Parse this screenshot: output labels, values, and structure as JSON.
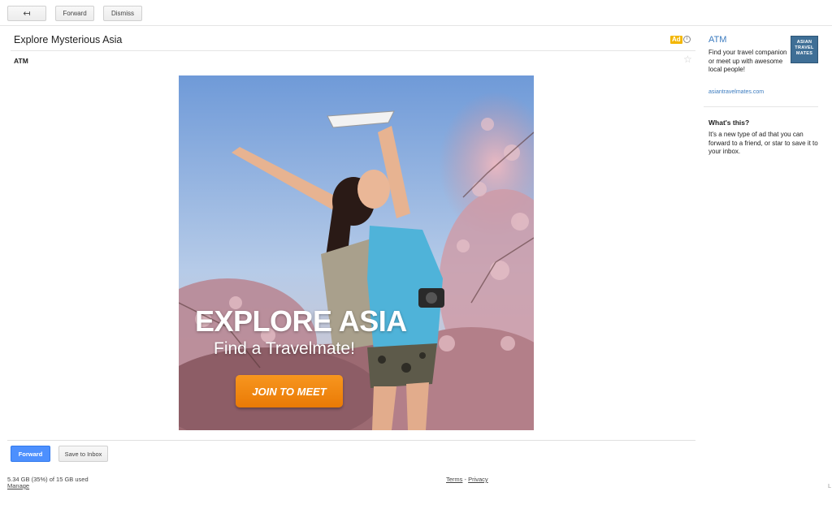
{
  "toolbar": {
    "back_label": "↤",
    "forward_label": "Forward",
    "dismiss_label": "Dismiss"
  },
  "message": {
    "subject": "Explore Mysterious Asia",
    "ad_badge": "Ad",
    "info_glyph": "i",
    "star_glyph": "☆",
    "sender": "ATM"
  },
  "ad_creative": {
    "headline": "EXPLORE ASIA",
    "subheadline": "Find a Travelmate!",
    "cta": "JOIN TO MEET"
  },
  "actions": {
    "forward_label": "Forward",
    "save_label": "Save to Inbox"
  },
  "footer": {
    "storage": "5.34 GB (35%) of 15 GB used",
    "manage": "Manage",
    "terms": "Terms",
    "separator": " - ",
    "privacy": "Privacy",
    "edge": "L"
  },
  "sidebar": {
    "advertiser": "ATM",
    "description": "Find your travel companion or meet up with awesome local people!",
    "logo_lines": [
      "ASIAN",
      "TRAVEL",
      "MATES"
    ],
    "url": "asiantravelmates.com",
    "whats_title": "What's this?",
    "whats_text": "It's a new type of ad that you can forward to a friend, or star to save it to your inbox."
  },
  "colors": {
    "primary_button": "#4d90fe",
    "ad_badge": "#f3b600",
    "link": "#3b7bbf",
    "cta": "#f7961f"
  }
}
